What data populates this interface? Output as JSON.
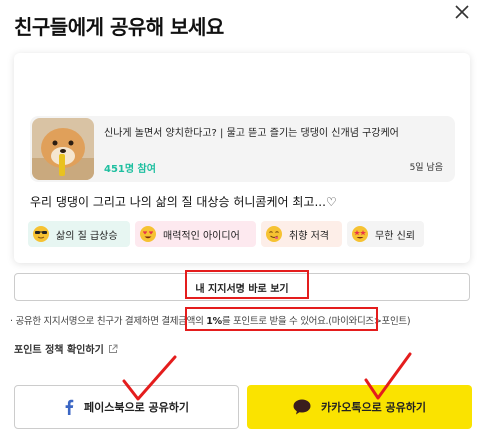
{
  "dialog": {
    "title": "친구들에게 공유해 보세요"
  },
  "project": {
    "title": "신나게 놀면서 양치한다고? | 물고 뜯고 즐기는 댕댕이 신개념 구강케어",
    "participants": "451명 참여",
    "days_left": "5일 남음"
  },
  "comment": "우리 댕댕이 그리고 나의 삶의 질 대상승 허니콤케어 최고...♡",
  "chips": [
    {
      "label": "삶의 질 급상승",
      "icon": "sunglasses-emoji-icon"
    },
    {
      "label": "매력적인 아이디어",
      "icon": "heart-eyes-emoji-icon"
    },
    {
      "label": "취향 저격",
      "icon": "yum-emoji-icon"
    },
    {
      "label": "무한 신뢰",
      "icon": "star-eyes-emoji-icon"
    }
  ],
  "my_support_button": "내 지지서명 바로 보기",
  "notice": {
    "prefix": "· 공유한 지지서명으로 친구가 결제하면 ",
    "highlight_a": "결제금액의 ",
    "highlight_b": "1%",
    "highlight_c": "를 포인트로 받을 수 있어요.",
    "suffix": "(마이와디즈>포인트)"
  },
  "policy_link": "포인트 정책 확인하기",
  "share_buttons": {
    "facebook": "페이스북으로 공유하기",
    "kakao": "카카오톡으로 공유하기"
  },
  "colors": {
    "accent_teal": "#1fbfa0",
    "kakao_yellow": "#fae300",
    "annotation_red": "#e41d1d"
  }
}
